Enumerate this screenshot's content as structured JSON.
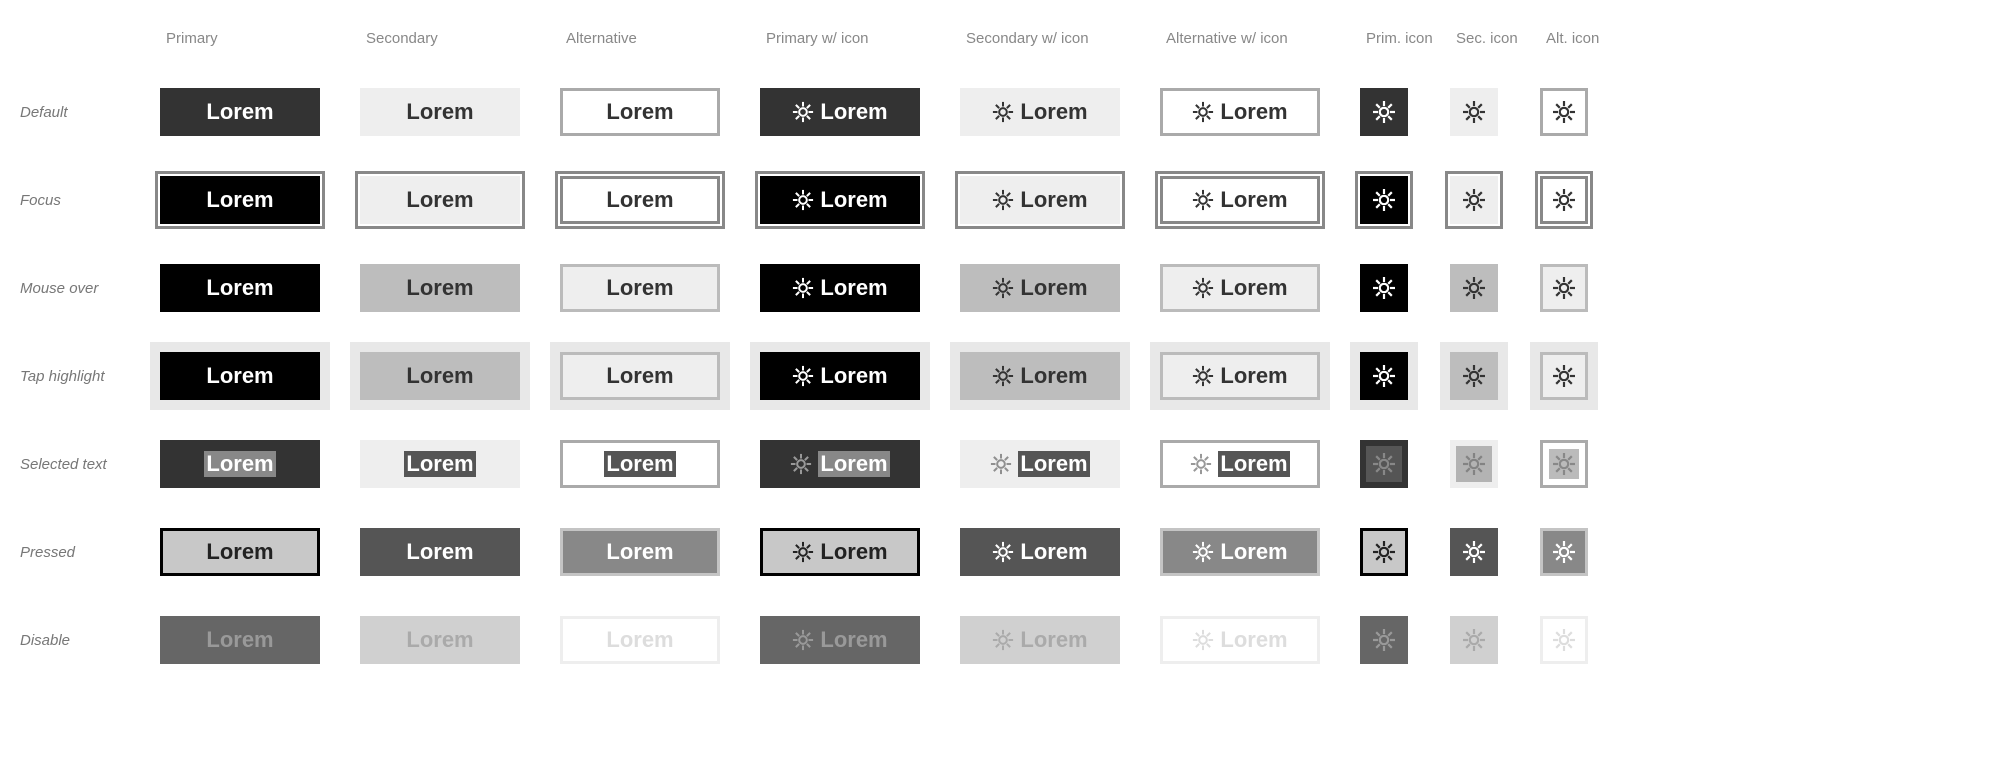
{
  "label": "Lorem",
  "columns": [
    "Primary",
    "Secondary",
    "Alternative",
    "Primary w/ icon",
    "Secondary w/ icon",
    "Alternative w/ icon",
    "Prim. icon",
    "Sec. icon",
    "Alt. icon"
  ],
  "rows": [
    "Default",
    "Focus",
    "Mouse over",
    "Tap highlight",
    "Selected text",
    "Pressed",
    "Disable"
  ],
  "icon": "gear"
}
